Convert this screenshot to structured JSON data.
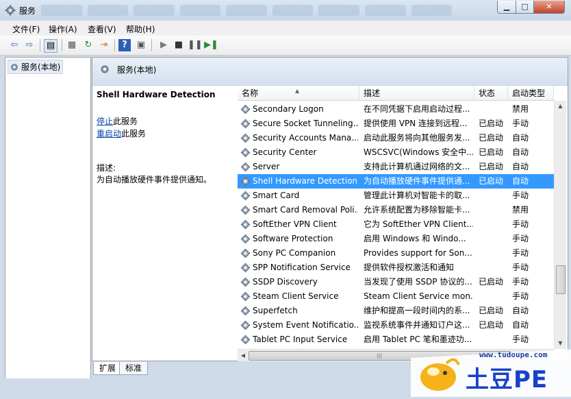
{
  "window": {
    "title": "服务"
  },
  "menu": [
    "文件(F)",
    "操作(A)",
    "查看(V)",
    "帮助(H)"
  ],
  "tree": {
    "root": "服务(本地)"
  },
  "header": {
    "title": "服务(本地)"
  },
  "detail": {
    "service_name": "Shell Hardware Detection",
    "stop_link": "停止",
    "stop_suffix": "此服务",
    "restart_link": "重启动",
    "restart_suffix": "此服务",
    "desc_label": "描述:",
    "desc_text": "为自动播放硬件事件提供通知。"
  },
  "columns": {
    "name": "名称",
    "desc": "描述",
    "status": "状态",
    "start": "启动类型"
  },
  "rows": [
    {
      "name": "Secondary Logon",
      "desc": "在不同凭据下启用启动过程...",
      "status": "",
      "start": "禁用"
    },
    {
      "name": "Secure Socket Tunneling...",
      "desc": "提供使用 VPN 连接到远程...",
      "status": "已启动",
      "start": "手动"
    },
    {
      "name": "Security Accounts Mana...",
      "desc": "启动此服务将向其他服务发...",
      "status": "已启动",
      "start": "自动"
    },
    {
      "name": "Security Center",
      "desc": "WSCSVC(Windows 安全中...",
      "status": "已启动",
      "start": "自动"
    },
    {
      "name": "Server",
      "desc": "支持此计算机通过网络的文...",
      "status": "已启动",
      "start": "自动"
    },
    {
      "name": "Shell Hardware Detection",
      "desc": "为自动播放硬件事件提供通...",
      "status": "已启动",
      "start": "自动"
    },
    {
      "name": "Smart Card",
      "desc": "管理此计算机对智能卡的取...",
      "status": "",
      "start": "手动"
    },
    {
      "name": "Smart Card Removal Poli...",
      "desc": "允许系统配置为移除智能卡...",
      "status": "",
      "start": "禁用"
    },
    {
      "name": "SoftEther VPN Client",
      "desc": "它为 SoftEther VPN Client...",
      "status": "",
      "start": "手动"
    },
    {
      "name": "Software Protection",
      "desc": "启用 Windows 和 Windo...",
      "status": "",
      "start": "手动"
    },
    {
      "name": "Sony PC Companion",
      "desc": "Provides support for Son...",
      "status": "",
      "start": "手动"
    },
    {
      "name": "SPP Notification Service",
      "desc": "提供软件授权激活和通知",
      "status": "",
      "start": "手动"
    },
    {
      "name": "SSDP Discovery",
      "desc": "当发现了使用 SSDP 协议的...",
      "status": "已启动",
      "start": "手动"
    },
    {
      "name": "Steam Client Service",
      "desc": "Steam Client Service mon...",
      "status": "",
      "start": "手动"
    },
    {
      "name": "Superfetch",
      "desc": "维护和提高一段时间内的系...",
      "status": "已启动",
      "start": "自动"
    },
    {
      "name": "System Event Notificatio...",
      "desc": "监视系统事件并通知订户这...",
      "status": "已启动",
      "start": "自动"
    },
    {
      "name": "Tablet PC Input Service",
      "desc": "启用 Tablet PC 笔和墨迹功...",
      "status": "",
      "start": "手动"
    }
  ],
  "selected_row": "Shell Hardware Detection",
  "tabs": [
    "扩展",
    "标准"
  ],
  "watermark": {
    "url": "www.tudoupe.com",
    "logo_text": "土豆PE"
  },
  "colors": {
    "selection": "#3399ff",
    "link": "#0645ad",
    "frame": "#cfdbe8"
  }
}
